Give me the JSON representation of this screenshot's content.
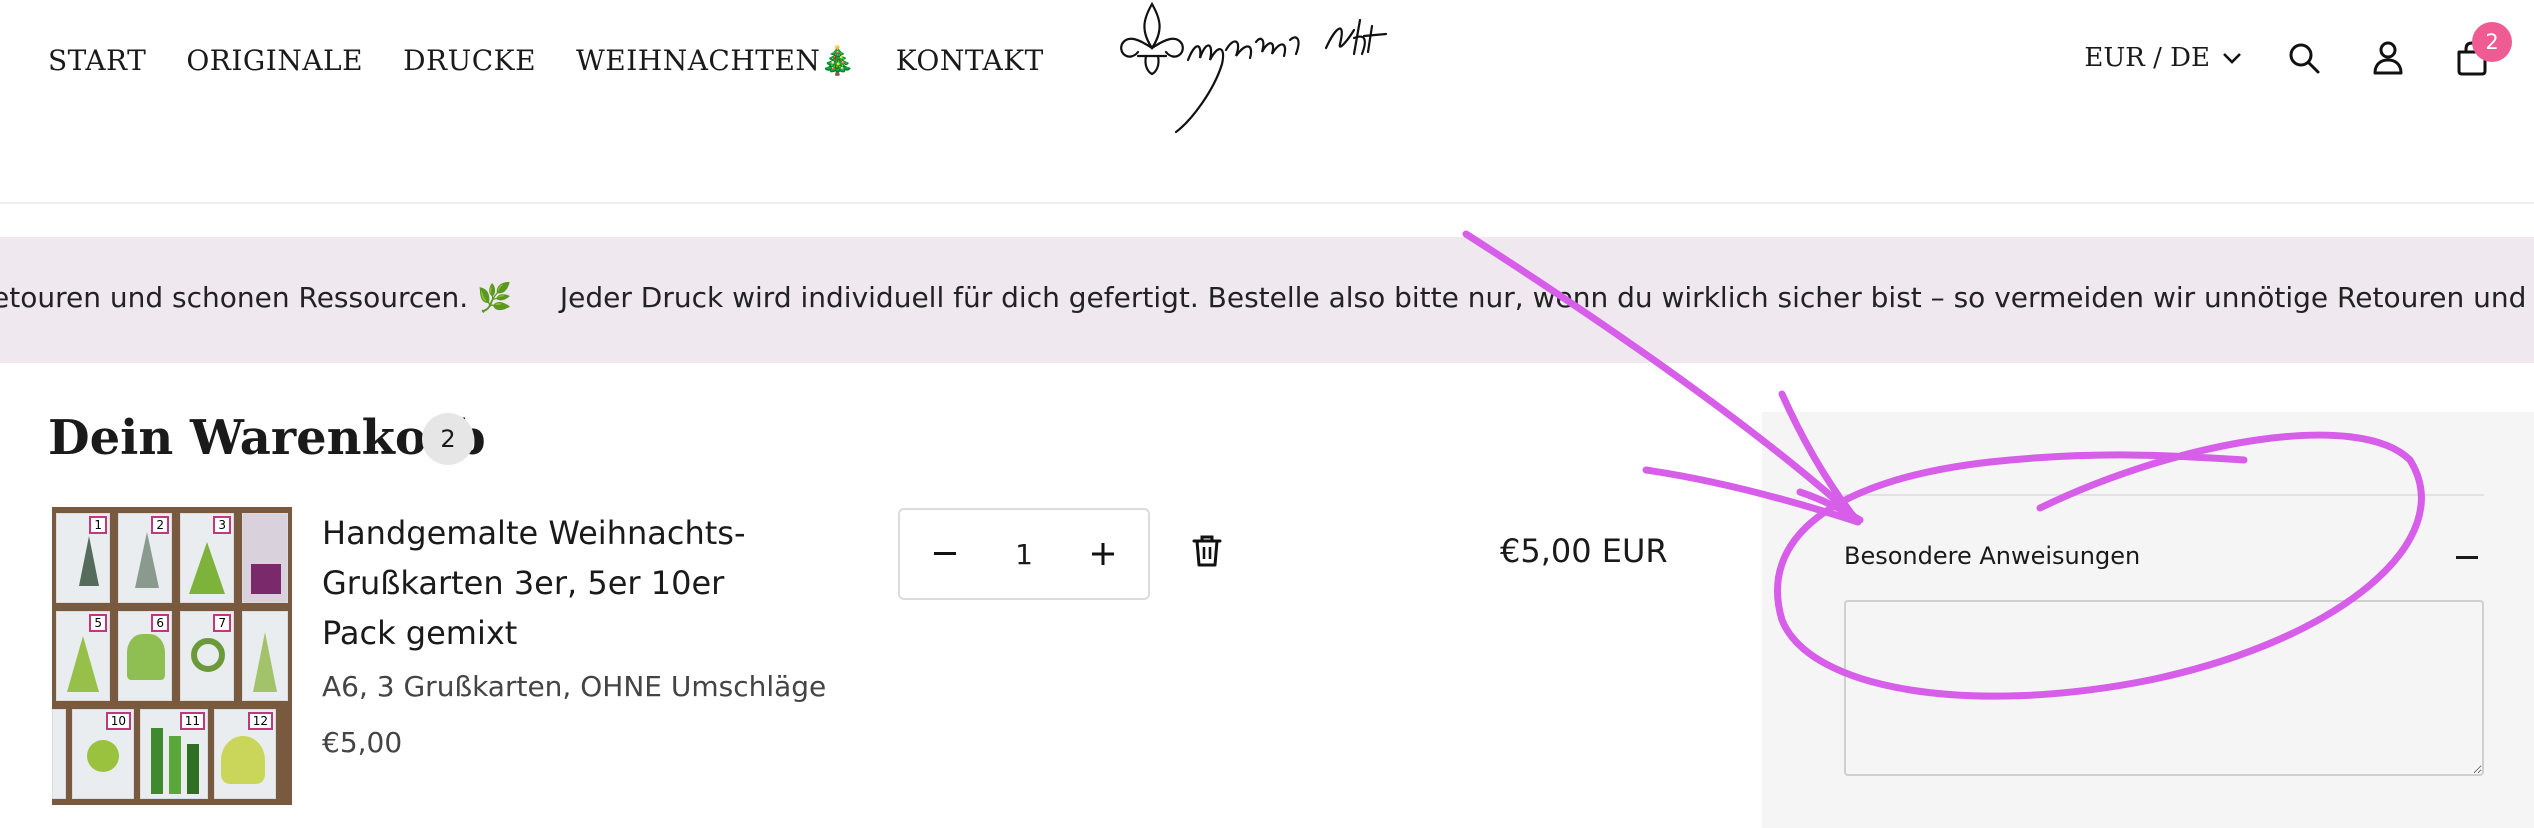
{
  "nav": {
    "items": [
      "START",
      "ORIGINALE",
      "DRUCKE",
      "WEIHNACHTEN🎄",
      "KONTAKT"
    ]
  },
  "header": {
    "currency": "EUR / DE",
    "cart_count": "2"
  },
  "announcement": {
    "segments": [
      "etouren und schonen Ressourcen. 🌿",
      "Jeder Druck wird individuell für dich gefertigt. Bestelle also bitte nur, wenn du wirklich sicher bist – so vermeiden wir unnötige Retouren und schonen R"
    ]
  },
  "cart": {
    "title": "Dein Warenkorb",
    "count": "2",
    "item": {
      "title": "Handgemalte Weihnachts-Grußkarten 3er, 5er 10er Pack gemixt",
      "variant": "A6, 3 Grußkarten, OHNE Umschläge",
      "price": "€5,00",
      "quantity": "1",
      "line_total": "€5,00 EUR",
      "thumb_numbers": [
        "1",
        "2",
        "3",
        "5",
        "6",
        "7",
        "10",
        "11",
        "12"
      ]
    }
  },
  "sidebar": {
    "notes_label": "Besondere Anweisungen",
    "notes_value": ""
  },
  "colors": {
    "badge": "#ee5c93",
    "announcement_bg": "#efe8ef",
    "annotation": "#d65ee8"
  }
}
